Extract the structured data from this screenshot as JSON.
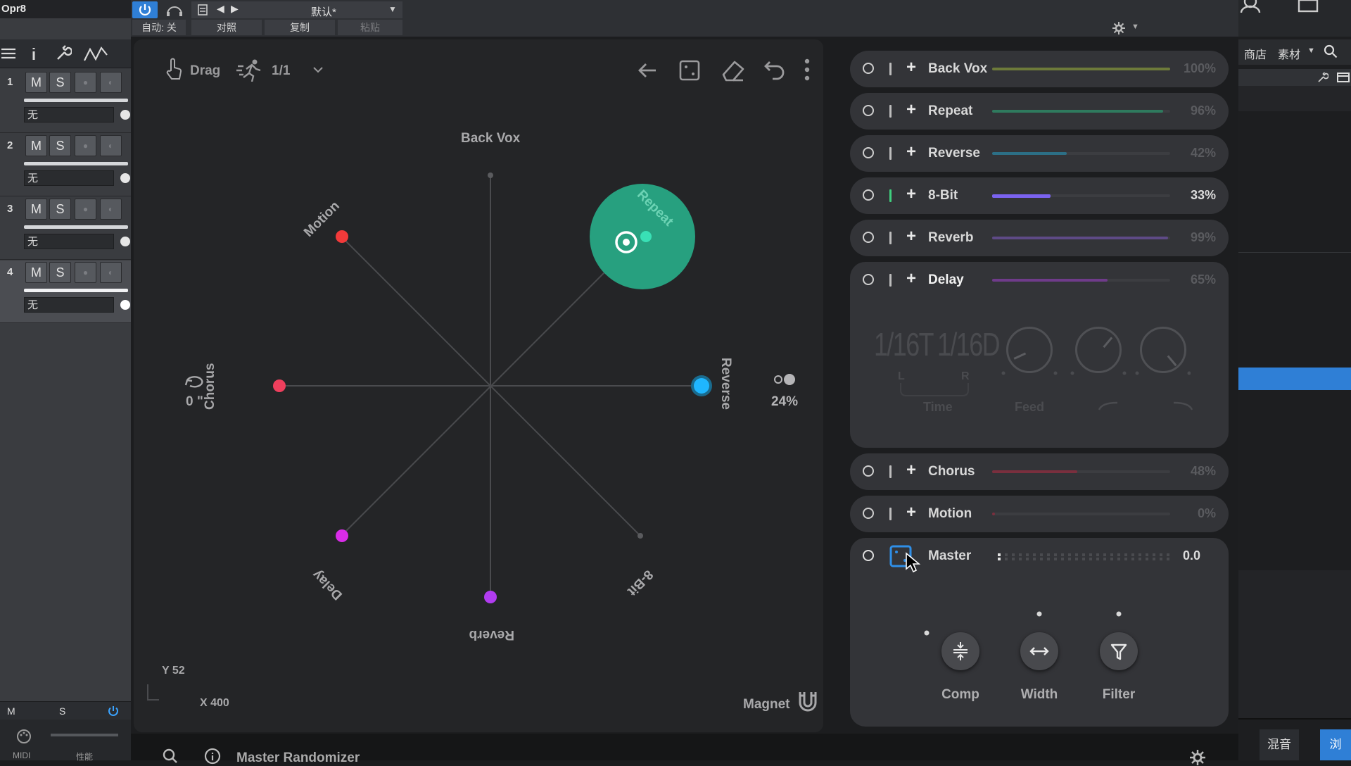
{
  "daw": {
    "top_left_label": "Opr8",
    "auto_label": "自动: 关",
    "compare_label": "对照",
    "copy_label": "复制",
    "paste_label": "粘贴",
    "preset_name": "默认*",
    "tracks": [
      {
        "num": "1",
        "m": "M",
        "s": "S",
        "input": "无"
      },
      {
        "num": "2",
        "m": "M",
        "s": "S",
        "input": "无"
      },
      {
        "num": "3",
        "m": "M",
        "s": "S",
        "input": "无"
      },
      {
        "num": "4",
        "m": "M",
        "s": "S",
        "input": "无"
      }
    ],
    "bottom_m": "M",
    "bottom_s": "S",
    "bottom_midi": "MIDI",
    "bottom_perf": "性能",
    "right_shop": "商店",
    "right_material": "素材",
    "right_tab_mix": "混音",
    "right_tab_b": "浏"
  },
  "toolbar": {
    "drag_label": "Drag",
    "ratio_label": "1/1"
  },
  "pad": {
    "labels": {
      "back_vox": "Back Vox",
      "repeat": "Repeat",
      "reverse": "Reverse",
      "eight_bit": "8-Bit",
      "reverb": "Reverb",
      "delay": "Delay",
      "chorus": "Chorus",
      "motion": "Motion"
    },
    "rotation_label": "0 \"",
    "reverse_pct": "24%",
    "y_readout": "Y 52",
    "x_readout": "X 400",
    "magnet_label": "Magnet"
  },
  "fx": [
    {
      "name": "Back Vox",
      "pct": "100%",
      "value": 1.0,
      "color": "#6d7a3a",
      "bright": false
    },
    {
      "name": "Repeat",
      "pct": "96%",
      "value": 0.96,
      "color": "#2f7a5e",
      "bright": false
    },
    {
      "name": "Reverse",
      "pct": "42%",
      "value": 0.42,
      "color": "#2c6f86",
      "bright": false
    },
    {
      "name": "8-Bit",
      "pct": "33%",
      "value": 0.33,
      "color": "#7b63f0",
      "bright": true
    },
    {
      "name": "Reverb",
      "pct": "99%",
      "value": 0.99,
      "color": "#5e4a86",
      "bright": false
    },
    {
      "name": "Delay",
      "pct": "65%",
      "value": 0.65,
      "color": "#6f3b8a",
      "bright": false
    },
    {
      "name": "Chorus",
      "pct": "48%",
      "value": 0.48,
      "color": "#7a2f3e",
      "bright": false
    },
    {
      "name": "Motion",
      "pct": "0%",
      "value": 0.0,
      "color": "#7a2f3e",
      "bright": false
    }
  ],
  "delay_panel": {
    "left_value": "1/16T",
    "right_value": "1/16D",
    "l_label": "L",
    "r_label": "R",
    "time_label": "Time",
    "feed_label": "Feed"
  },
  "master": {
    "name": "Master",
    "value": "0.0",
    "buttons": [
      "Comp",
      "Width",
      "Filter"
    ]
  },
  "footer": {
    "title": "Master Randomizer"
  }
}
